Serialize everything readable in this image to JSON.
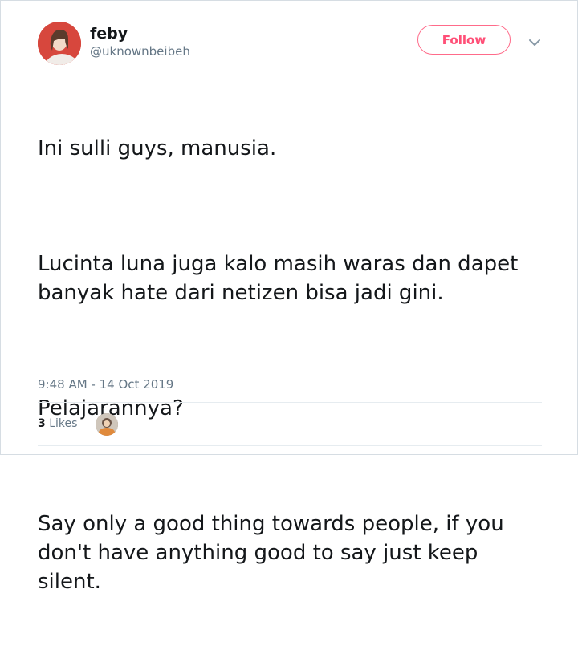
{
  "author": {
    "display_name": "feby",
    "handle": "@uknownbeibeh"
  },
  "follow_label": "Follow",
  "tweet": {
    "paragraphs": [
      "Ini sulli guys, manusia.",
      "Lucinta luna juga kalo masih waras dan dapet\nbanyak hate dari netizen bisa jadi gini.",
      "Pelajarannya?",
      "Say only a good thing towards people, if you\ndon't have anything good to say just keep\nsilent."
    ],
    "timestamp": "9:48 AM - 14 Oct 2019"
  },
  "engagement": {
    "likes_count": "3",
    "likes_label": "Likes"
  },
  "colors": {
    "follow_accent": "#ff4f77",
    "secondary_text": "#657786",
    "primary_text": "#14171a"
  }
}
